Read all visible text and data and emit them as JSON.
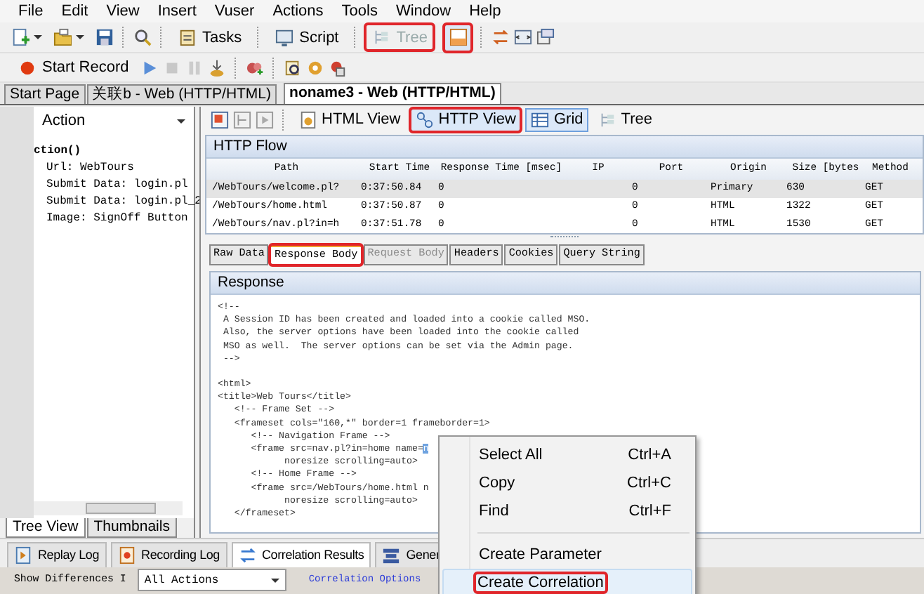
{
  "menu": [
    "File",
    "Edit",
    "View",
    "Insert",
    "Vuser",
    "Actions",
    "Tools",
    "Window",
    "Help"
  ],
  "toolbar": {
    "buttons": [
      {
        "label": "Tasks",
        "disabled": false,
        "annotated": false
      },
      {
        "label": "Script",
        "disabled": false,
        "annotated": false
      },
      {
        "label": "Tree",
        "disabled": true,
        "annotated": true
      }
    ],
    "pane_button": {
      "annotated": true
    }
  },
  "record_toolbar": {
    "start_record": "Start Record"
  },
  "document_tabs": [
    {
      "label": "Start Page",
      "selected": false
    },
    {
      "label": "关联b - Web (HTTP/HTML)",
      "selected": false
    },
    {
      "label": "noname3 - Web (HTTP/HTML)",
      "selected": true
    }
  ],
  "left_pane": {
    "dropdown": "Action",
    "tree": [
      {
        "text": "ction()",
        "children": [
          {
            "text": "Url: WebTours"
          },
          {
            "text": "Submit Data: login.pl"
          },
          {
            "text": "Submit Data: login.pl_2"
          },
          {
            "text": "Image: SignOff Button"
          }
        ]
      }
    ],
    "tabs": [
      {
        "label": "Tree View",
        "selected": true
      },
      {
        "label": "Thumbnails",
        "selected": false
      }
    ]
  },
  "view_toolbar": {
    "views": [
      {
        "label": "HTML View",
        "selected": false,
        "annotated": false
      },
      {
        "label": "HTTP View",
        "selected": true,
        "annotated": true
      }
    ],
    "modes": [
      {
        "label": "Grid",
        "selected": true
      },
      {
        "label": "Tree",
        "selected": false
      }
    ]
  },
  "http_flow": {
    "title": "HTTP Flow",
    "columns": [
      "Path",
      "Start Time",
      "Response Time [msec]",
      "IP",
      "Port",
      "Origin",
      "Size [bytes",
      "Method"
    ],
    "rows": [
      {
        "cells": [
          "/WebTours/welcome.pl?",
          "0:37:50.84",
          "0",
          "",
          "0",
          "Primary",
          "630",
          "GET"
        ],
        "selected": true
      },
      {
        "cells": [
          "/WebTours/home.html",
          "0:37:50.87",
          "0",
          "",
          "0",
          "HTML",
          "1322",
          "GET"
        ],
        "selected": false
      },
      {
        "cells": [
          "/WebTours/nav.pl?in=h",
          "0:37:51.78",
          "0",
          "",
          "0",
          "HTML",
          "1530",
          "GET"
        ],
        "selected": false
      }
    ]
  },
  "detail_tabs": [
    {
      "label": "Raw Data",
      "selected": false,
      "disabled": false,
      "annotated": false
    },
    {
      "label": "Response Body",
      "selected": true,
      "disabled": false,
      "annotated": true
    },
    {
      "label": "Request Body",
      "selected": false,
      "disabled": true,
      "annotated": false
    },
    {
      "label": "Headers",
      "selected": false,
      "disabled": false,
      "annotated": false
    },
    {
      "label": "Cookies",
      "selected": false,
      "disabled": false,
      "annotated": false
    },
    {
      "label": "Query String",
      "selected": false,
      "disabled": false,
      "annotated": false
    }
  ],
  "response": {
    "title": "Response",
    "blocks": [
      [
        "<!--",
        " A Session ID has been created and loaded into a cookie called MSO.",
        " Also, the server options have been loaded into the cookie called",
        " MSO as well.  The server options can be set via the Admin page.",
        " -->"
      ],
      [
        "<html>",
        "<title>Web Tours</title>",
        "   <!-- Frame Set -->",
        "   <frameset cols=\"160,*\" border=1 frameborder=1>",
        "      <!-- Navigation Frame -->",
        {
          "text": "      <frame src=nav.pl?in=home name=",
          "selected_text": "n"
        },
        "            noresize scrolling=auto>",
        "      <!-- Home Frame -->",
        "      <frame src=/WebTours/home.html n",
        "            noresize scrolling=auto>",
        "   </frameset>"
      ]
    ]
  },
  "bottom_tabs": [
    {
      "label": "Replay Log",
      "selected": false
    },
    {
      "label": "Recording Log",
      "selected": false
    },
    {
      "label": "Correlation Results",
      "selected": true
    },
    {
      "label": "Gener",
      "selected": false
    }
  ],
  "bottom_bar": {
    "label": "Show Differences I",
    "dropdown": "All Actions",
    "link": "Correlation Options"
  },
  "context_menu": {
    "items": [
      {
        "kind": "item",
        "label": "Select All",
        "shortcut": "Ctrl+A",
        "highlighted": false,
        "annotated": false
      },
      {
        "kind": "item",
        "label": "Copy",
        "shortcut": "Ctrl+C",
        "highlighted": false,
        "annotated": false
      },
      {
        "kind": "item",
        "label": "Find",
        "shortcut": "Ctrl+F",
        "highlighted": false,
        "annotated": false
      },
      {
        "kind": "separator"
      },
      {
        "kind": "item",
        "label": "Create Parameter",
        "highlighted": false,
        "annotated": false
      },
      {
        "kind": "item",
        "label": "Create Correlation",
        "highlighted": true,
        "annotated": true
      }
    ]
  }
}
